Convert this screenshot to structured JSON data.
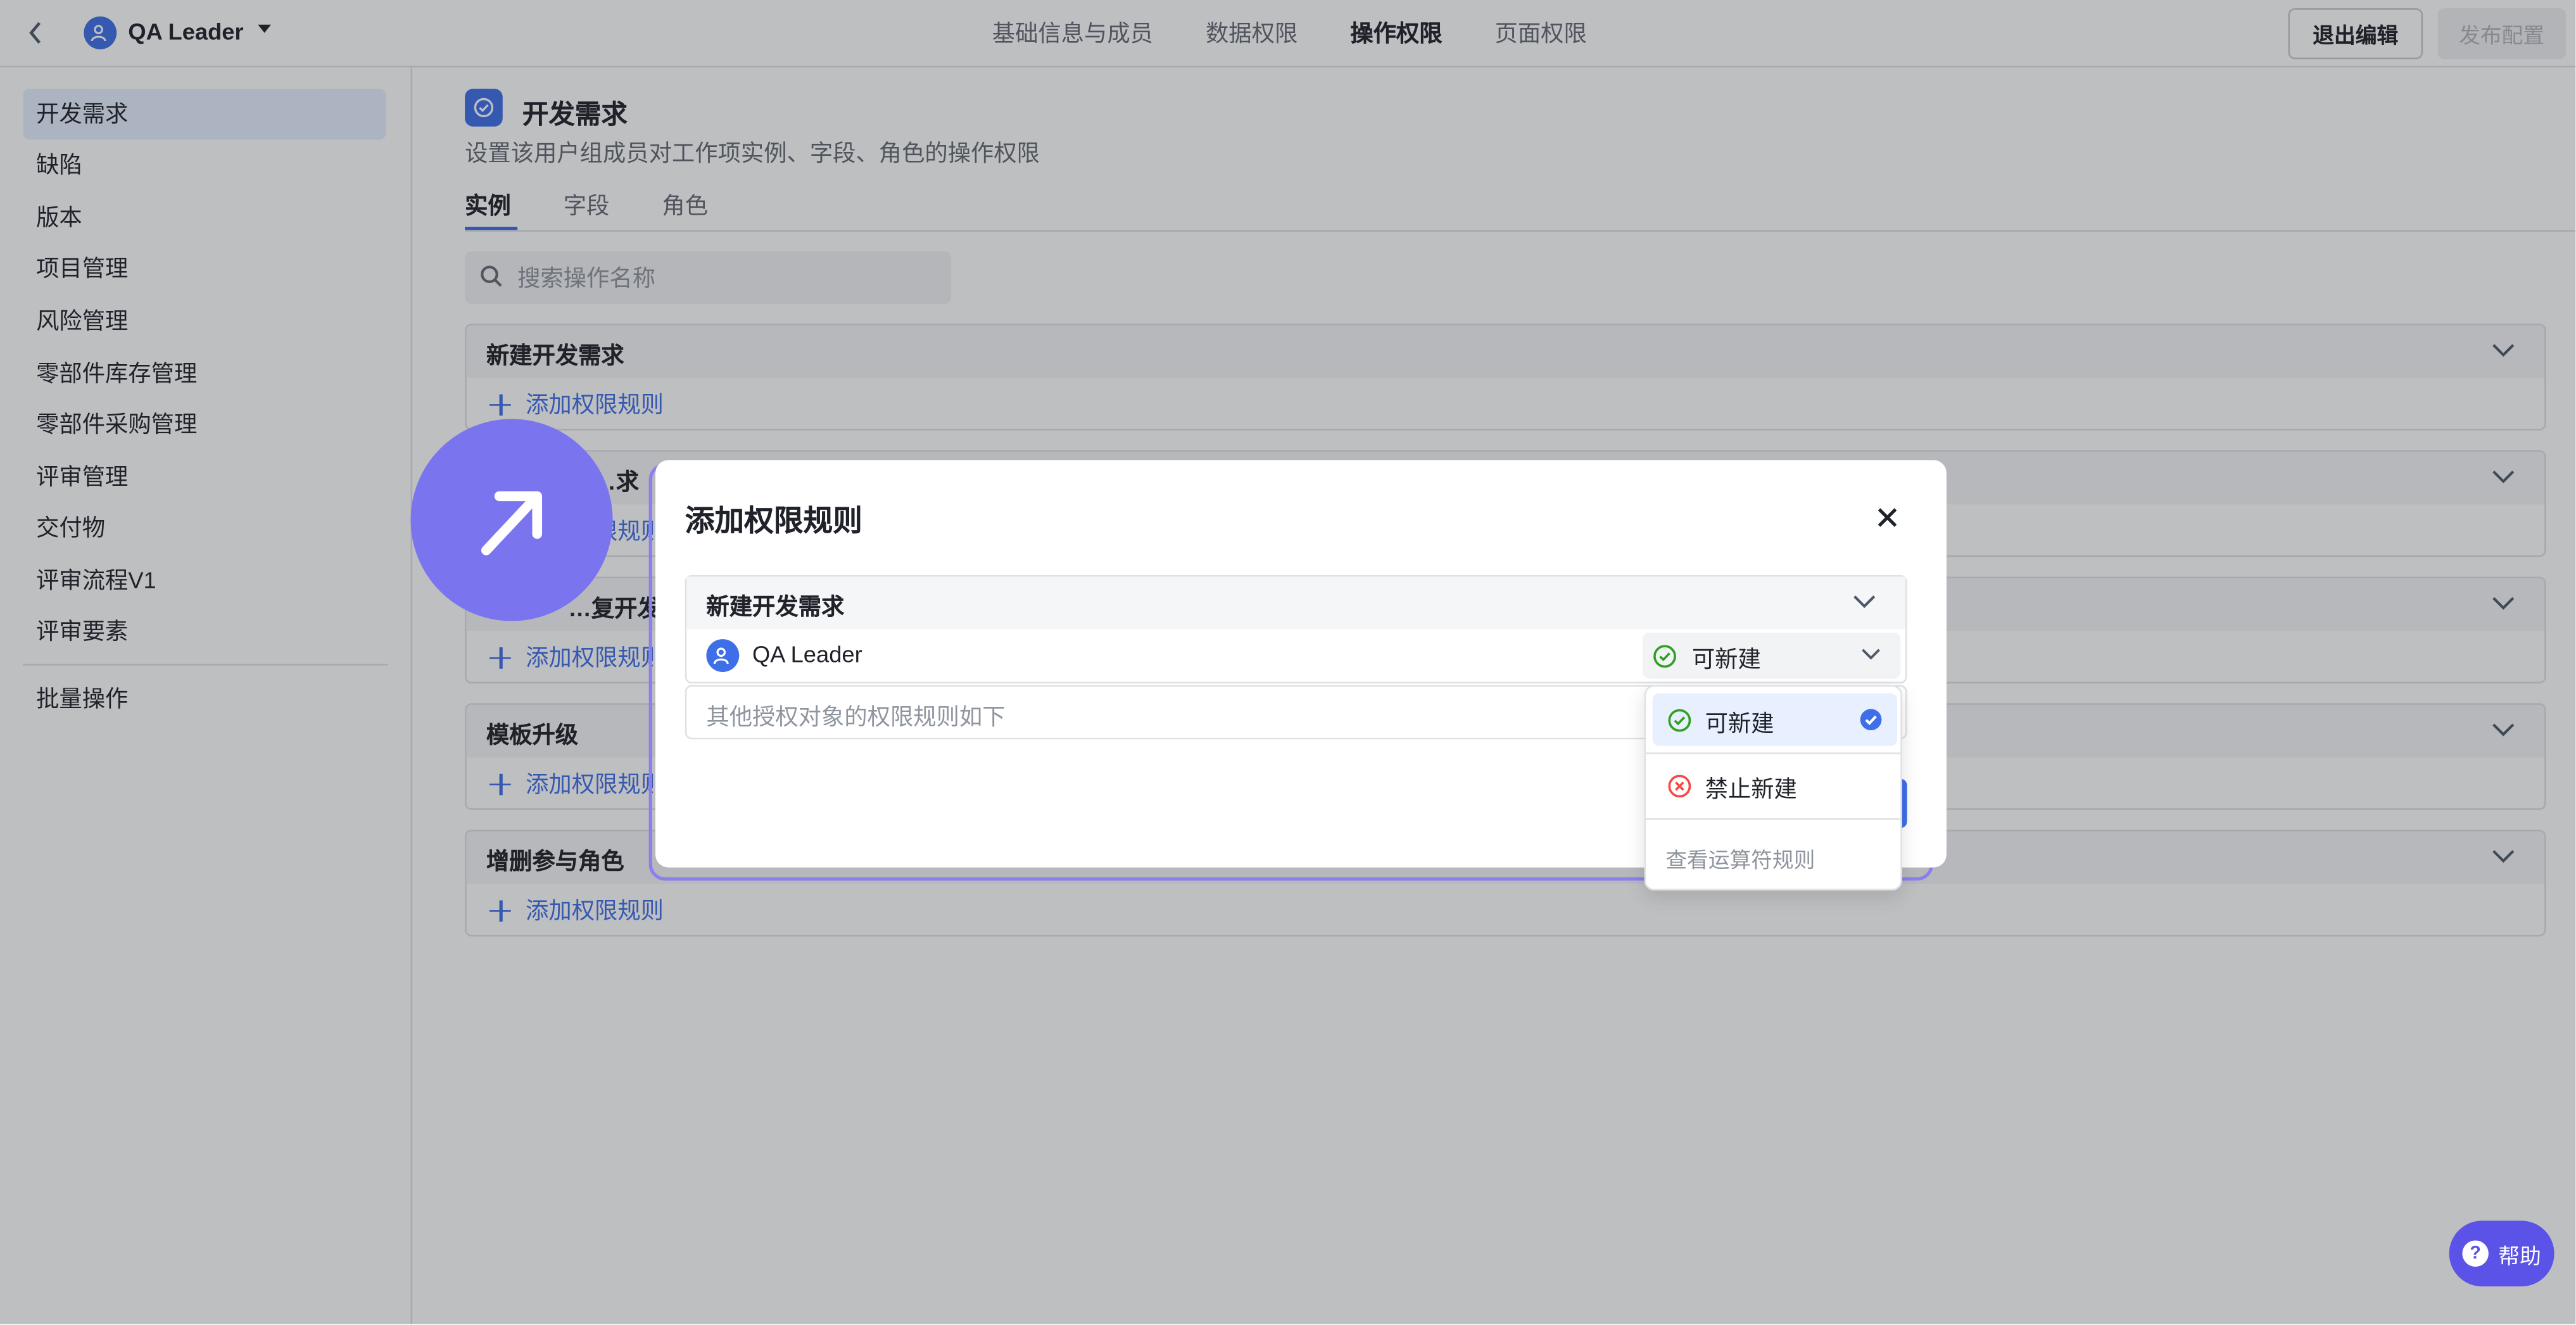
{
  "header": {
    "group_name": "QA Leader",
    "tabs": [
      "基础信息与成员",
      "数据权限",
      "操作权限",
      "页面权限"
    ],
    "active_tab": "操作权限",
    "exit_label": "退出编辑",
    "publish_label": "发布配置"
  },
  "sidebar": {
    "items": [
      "开发需求",
      "缺陷",
      "版本",
      "项目管理",
      "风险管理",
      "零部件库存管理",
      "零部件采购管理",
      "评审管理",
      "交付物",
      "评审流程V1",
      "评审要素"
    ],
    "active": "开发需求",
    "batch_label": "批量操作"
  },
  "main": {
    "title": "开发需求",
    "description": "设置该用户组成员对工作项实例、字段、角色的操作权限",
    "tabs": [
      "实例",
      "字段",
      "角色"
    ],
    "active_tab": "实例",
    "search_placeholder": "搜索操作名称",
    "add_rule_label": "添加权限规则",
    "sections": [
      "新建开发需求",
      "…求",
      "…复开发…",
      "模板升级",
      "增删参与角色"
    ]
  },
  "modal": {
    "title": "添加权限规则",
    "rule_title": "新建开发需求",
    "user_name": "QA Leader",
    "selected_value": "可新建",
    "other_text": "其他授权对象的权限规则如下"
  },
  "dropdown": {
    "options": [
      "可新建",
      "禁止新建"
    ],
    "selected": "可新建",
    "footer": "查看运算符规则"
  },
  "help_label": "帮助",
  "colors": {
    "accent": "#3f6fe8",
    "ok": "#2ea121",
    "deny": "#f54a45",
    "cursor_badge": "#7b74ef"
  }
}
